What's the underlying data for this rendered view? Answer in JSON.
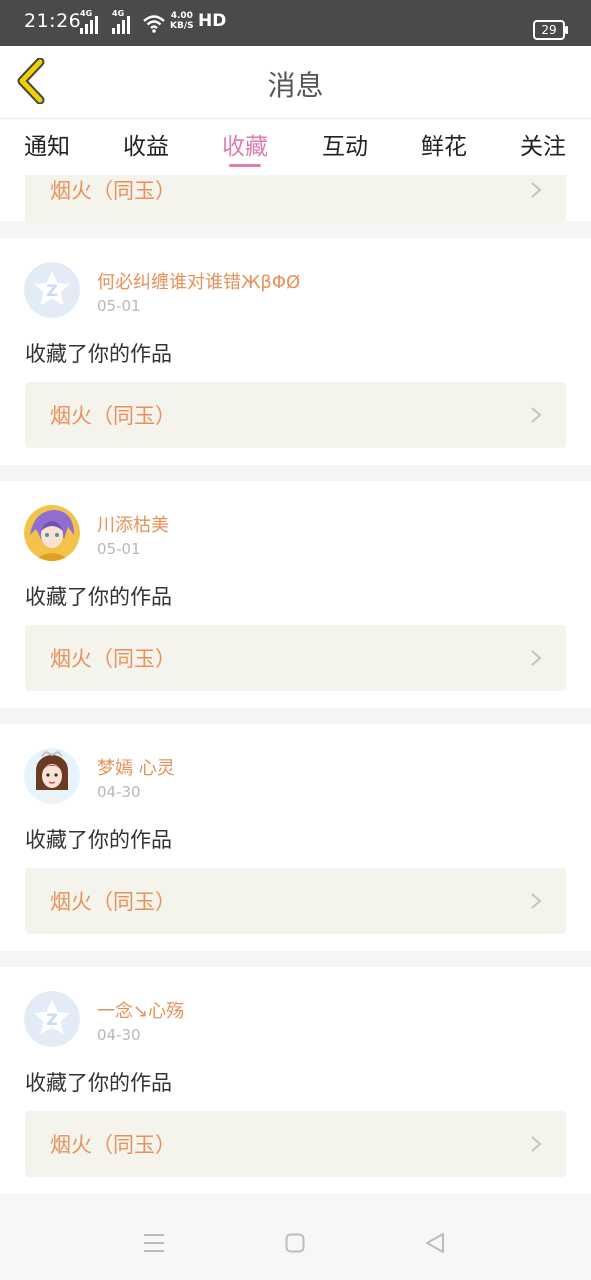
{
  "status_bar": {
    "time": "21:26",
    "signal1_label": "4G",
    "signal2_label": "4G",
    "speed_value": "4.00",
    "speed_unit": "KB/S",
    "network_label": "HD",
    "battery_level": "29"
  },
  "header": {
    "title": "消息"
  },
  "tabs": [
    {
      "label": "通知",
      "active": false
    },
    {
      "label": "收益",
      "active": false
    },
    {
      "label": "收藏",
      "active": true
    },
    {
      "label": "互动",
      "active": false
    },
    {
      "label": "鲜花",
      "active": false
    },
    {
      "label": "关注",
      "active": false
    }
  ],
  "partial_card": {
    "work_title": "烟火（同玉）"
  },
  "messages": [
    {
      "user_name": "何必纠缠谁对谁错ЖβΦØ",
      "date": "05-01",
      "action": "收藏了你的作品",
      "work_title": "烟火（同玉）",
      "avatar": "default-avatar-icon"
    },
    {
      "user_name": "川添枯美",
      "date": "05-01",
      "action": "收藏了你的作品",
      "work_title": "烟火（同玉）",
      "avatar": "anime-avatar"
    },
    {
      "user_name": "梦嫣 心灵",
      "date": "04-30",
      "action": "收藏了你的作品",
      "work_title": "烟火（同玉）",
      "avatar": "doll-avatar"
    },
    {
      "user_name": "一念↘心殇",
      "date": "04-30",
      "action": "收藏了你的作品",
      "work_title": "烟火（同玉）",
      "avatar": "default-avatar-icon"
    }
  ],
  "colors": {
    "accent_pink": "#e07cb0",
    "name_orange": "#e8915a",
    "work_bg": "#f4f4ec",
    "back_arrow": "#f0d000"
  }
}
